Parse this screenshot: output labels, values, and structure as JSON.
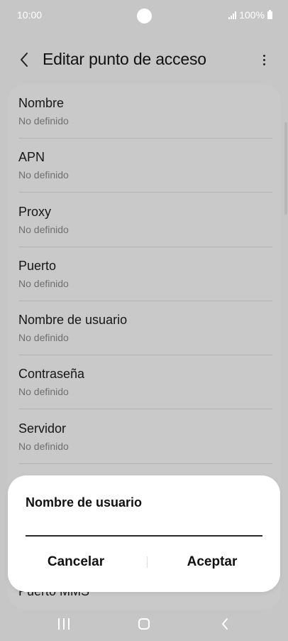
{
  "status_bar": {
    "time": "10:00",
    "battery": "100%"
  },
  "app_bar": {
    "title": "Editar punto de acceso",
    "back_icon": "chevron-left-icon",
    "more_icon": "more-vertical-icon"
  },
  "list": {
    "items": [
      {
        "title": "Nombre",
        "value": "No definido"
      },
      {
        "title": "APN",
        "value": "No definido"
      },
      {
        "title": "Proxy",
        "value": "No definido"
      },
      {
        "title": "Puerto",
        "value": "No definido"
      },
      {
        "title": "Nombre de usuario",
        "value": "No definido"
      },
      {
        "title": "Contraseña",
        "value": "No definido"
      },
      {
        "title": "Servidor",
        "value": "No definido"
      }
    ],
    "peek_item": "Puerto MMS"
  },
  "dialog": {
    "title": "Nombre de usuario",
    "input_value": "",
    "cancel_label": "Cancelar",
    "accept_label": "Aceptar"
  },
  "colors": {
    "background": "#c6c6c6",
    "dialog": "#ffffff",
    "text_primary": "#161616",
    "text_secondary": "#6f6f6f"
  }
}
